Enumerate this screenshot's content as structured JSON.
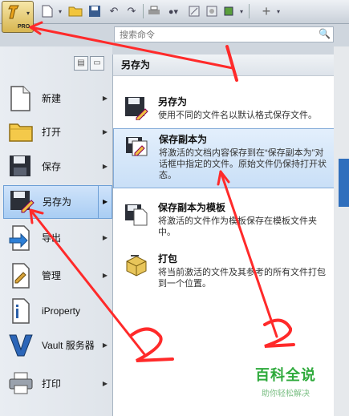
{
  "toolbar": {
    "app_badge": "PRO",
    "icons": [
      "new-icon",
      "open-icon",
      "save-icon",
      "undo-icon",
      "redo-icon",
      "print-icon",
      "pick-icon",
      "sketch-icon",
      "measure-icon",
      "view-icon",
      "add-icon",
      "customize-icon"
    ]
  },
  "search": {
    "placeholder": "搜索命令"
  },
  "left_menu": {
    "items": [
      {
        "label": "新建",
        "icon": "new-document-icon"
      },
      {
        "label": "打开",
        "icon": "folder-open-icon"
      },
      {
        "label": "保存",
        "icon": "floppy-icon"
      },
      {
        "label": "另存为",
        "icon": "save-as-icon",
        "active": true
      },
      {
        "label": "导出",
        "icon": "export-icon"
      },
      {
        "label": "管理",
        "icon": "manage-icon"
      },
      {
        "label": "iProperty",
        "icon": "iproperty-icon"
      },
      {
        "label": "Vault 服务器",
        "icon": "vault-icon"
      },
      {
        "label": "打印",
        "icon": "printer-icon"
      }
    ]
  },
  "submenu": {
    "title": "另存为",
    "items": [
      {
        "title": "另存为",
        "desc": "使用不同的文件名以默认格式保存文件。"
      },
      {
        "title": "保存副本为",
        "desc": "将激活的文档内容保存到在“保存副本为”对话框中指定的文件。原始文件仍保持打开状态。",
        "highlighted": true
      },
      {
        "title": "保存副本为模板",
        "desc": "将激活的文件作为模板保存在模板文件夹中。"
      },
      {
        "title": "打包",
        "desc": "将当前激活的文件及其参考的所有文件打包到一个位置。"
      }
    ]
  },
  "annotations": {
    "step1": "1",
    "step2a": "2",
    "step2b": "2",
    "color": "#ff2a2a"
  },
  "watermark": {
    "brand": "百科全说",
    "tagline": "助你轻松解决"
  },
  "colors": {
    "accent": "#a9cdf3",
    "highlight_border": "#84acd9",
    "watermark": "#2faa3c"
  }
}
